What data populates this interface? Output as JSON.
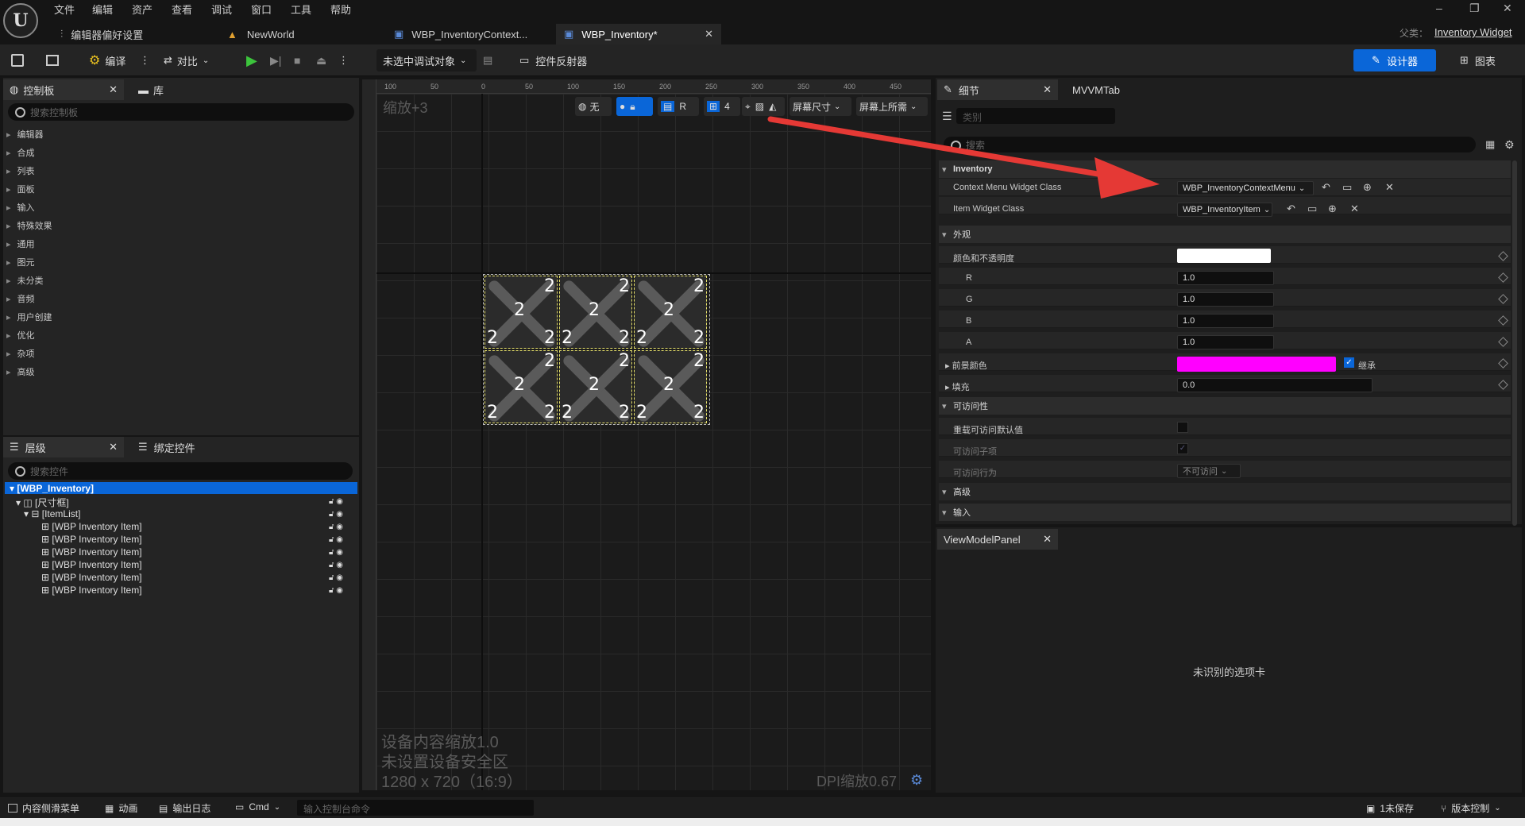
{
  "menubar": {
    "items": [
      "文件",
      "编辑",
      "资产",
      "查看",
      "调试",
      "窗口",
      "工具",
      "帮助"
    ],
    "parent_label": "父类：",
    "parent_value": "Inventory Widget"
  },
  "tabs": {
    "editor_prefs": "编辑器偏好设置",
    "new_world": "NewWorld",
    "context_menu": "WBP_InventoryContext...",
    "inventory": "WBP_Inventory*"
  },
  "toolbar": {
    "compile": "编译",
    "diff": "对比",
    "debug_target": "未选中调试对象",
    "widget_reflector": "控件反射器",
    "designer": "设计器",
    "graph": "图表"
  },
  "palette": {
    "tab_palette": "控制板",
    "tab_library": "库",
    "search_placeholder": "搜索控制板",
    "categories": [
      "编辑器",
      "合成",
      "列表",
      "面板",
      "输入",
      "特殊效果",
      "通用",
      "图元",
      "未分类",
      "音频",
      "用户创建",
      "优化",
      "杂项",
      "高级"
    ]
  },
  "hierarchy": {
    "tab_hierarchy": "层级",
    "tab_bind": "绑定控件",
    "search_placeholder": "搜索控件",
    "root": "[WBP_Inventory]",
    "size_box": "[尺寸框]",
    "item_list": "[ItemList]",
    "items": [
      "[WBP Inventory Item]",
      "[WBP Inventory Item]",
      "[WBP Inventory Item]",
      "[WBP Inventory Item]",
      "[WBP Inventory Item]",
      "[WBP Inventory Item]"
    ]
  },
  "viewport": {
    "zoom": "缩放+3",
    "tb_none": "无",
    "tb_r": "R",
    "tb_grid": "4",
    "screen_size": "屏幕尺寸",
    "fill_screen": "屏幕上所需",
    "ruler_top": [
      "100",
      "50",
      "0",
      "50",
      "100",
      "150",
      "200",
      "250",
      "300",
      "350",
      "400",
      "450"
    ],
    "cell_number": "2",
    "info_line1": "设备内容缩放1.0",
    "info_line2": "未设置设备安全区",
    "info_line3": "1280 x 720（16:9）",
    "dpi": "DPI缩放0.67"
  },
  "details": {
    "tab_details": "细节",
    "tab_mvvm": "MVVMTab",
    "category_placeholder": "类别",
    "search_placeholder": "搜索",
    "section_inventory": "Inventory",
    "context_menu_label": "Context Menu Widget Class",
    "context_menu_value": "WBP_InventoryContextMenu",
    "item_widget_label": "Item Widget Class",
    "item_widget_value": "WBP_InventoryItem",
    "section_appearance": "外观",
    "color_opacity": "颜色和不透明度",
    "r_label": "R",
    "r_value": "1.0",
    "g_label": "G",
    "g_value": "1.0",
    "b_label": "B",
    "b_value": "1.0",
    "a_label": "A",
    "a_value": "1.0",
    "foreground": "前景颜色",
    "inherit": "继承",
    "padding": "填充",
    "padding_value": "0.0",
    "section_accessibility": "可访问性",
    "override_access": "重载可访问默认值",
    "access_children": "可访问子项",
    "access_behavior": "可访问行为",
    "access_behavior_value": "不可访问",
    "section_advanced": "高级",
    "section_input": "输入"
  },
  "viewmodel": {
    "tab": "ViewModelPanel",
    "message": "未识别的选项卡"
  },
  "statusbar": {
    "content_drawer": "内容侧滑菜单",
    "animation": "动画",
    "output_log": "输出日志",
    "cmd": "Cmd",
    "console_placeholder": "输入控制台命令",
    "unsaved": "1未保存",
    "source_control": "版本控制"
  },
  "colors": {
    "accent": "#0a66d8",
    "foreground_swatch": "#ff00ff",
    "color_swatch": "#ffffff",
    "arrow": "#e53935",
    "selection": "#0a66d8"
  }
}
